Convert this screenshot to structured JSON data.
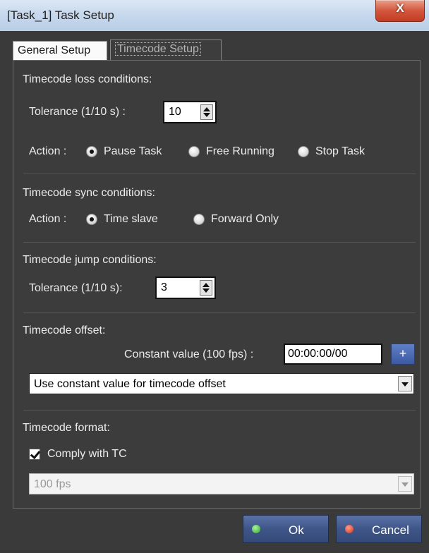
{
  "window": {
    "title": "[Task_1] Task Setup",
    "close_glyph": "X"
  },
  "tabs": [
    {
      "label": "General Setup",
      "active": false
    },
    {
      "label": "Timecode Setup",
      "active": true
    }
  ],
  "loss": {
    "heading": "Timecode loss conditions:",
    "tolerance_label": "Tolerance (1/10 s) :",
    "tolerance_value": "10",
    "action_label": "Action :",
    "options": [
      "Pause Task",
      "Free Running",
      "Stop Task"
    ],
    "selected": "Pause Task"
  },
  "sync": {
    "heading": "Timecode sync conditions:",
    "action_label": "Action :",
    "options": [
      "Time slave",
      "Forward Only"
    ],
    "selected": "Time slave"
  },
  "jump": {
    "heading": "Timecode jump conditions:",
    "tolerance_label": "Tolerance (1/10 s):",
    "tolerance_value": "3"
  },
  "offset": {
    "heading": "Timecode offset:",
    "constant_label": "Constant value (100 fps) :",
    "constant_value": "00:00:00/00",
    "plus_label": "+",
    "mode_selected": "Use constant value for timecode offset"
  },
  "format": {
    "heading": "Timecode format:",
    "comply_label": "Comply with TC",
    "comply_checked": true,
    "fps_selected": "100 fps"
  },
  "buttons": {
    "ok_label": "Ok",
    "cancel_label": "Cancel"
  },
  "icons": {
    "ok_led": "green-led-icon",
    "cancel_led": "red-led-icon"
  }
}
